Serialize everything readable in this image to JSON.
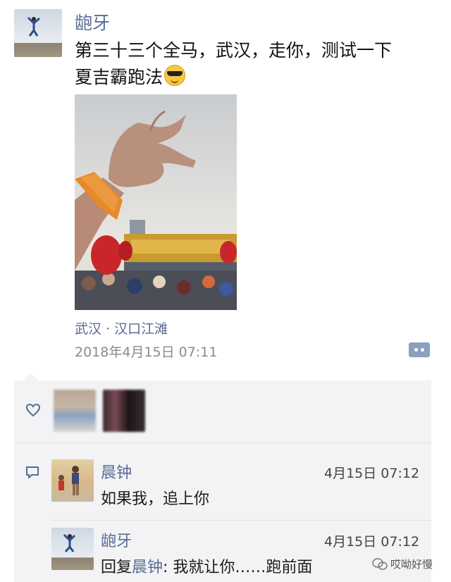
{
  "post": {
    "author": "龅牙",
    "text_line1": "第三十三个全马，武汉，走你，测试一下",
    "text_line2": "夏吉霸跑法",
    "emoji_icon": "cool-sunglasses-emoji",
    "location": "武汉 · 汉口江滩",
    "datetime": "2018年4月15日 07:11"
  },
  "likes": {
    "icon": "heart-icon"
  },
  "comments": [
    {
      "name": "晨钟",
      "time": "4月15日 07:12",
      "text": "如果我，追上你"
    },
    {
      "name": "龅牙",
      "time": "4月15日 07:12",
      "reply_prefix": "回复",
      "reply_to": "晨钟",
      "reply_text": ": 我就让你……跑前面"
    }
  ],
  "watermark": "哎呦好慢",
  "colors": {
    "link_blue": "#576b95",
    "panel_bg": "#f3f3f5",
    "watch_band": "#e58a2b"
  }
}
